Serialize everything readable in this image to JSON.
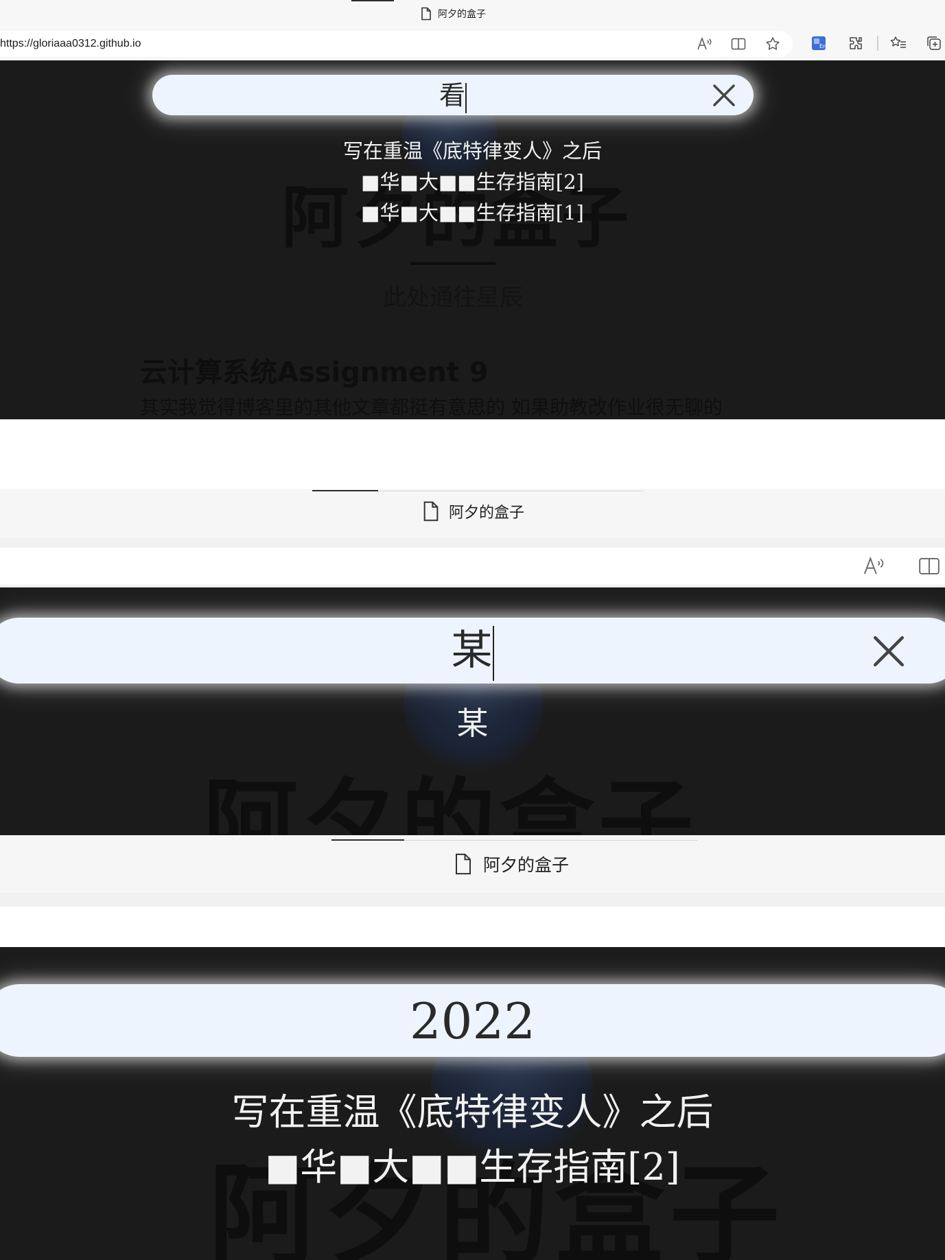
{
  "panel1": {
    "tab": {
      "title": "阿夕的盒子",
      "icon": "document-icon"
    },
    "address": {
      "url": "https://gloriaaa0312.github.io"
    },
    "toolbar_icons": [
      "read-aloud-icon",
      "split-screen-icon",
      "favorite-star-icon",
      "translate-icon",
      "extensions-icon",
      "favorites-list-icon",
      "collections-icon"
    ],
    "page": {
      "site_title": "阿夕的盒子",
      "site_subtitle": "此处通往星辰",
      "post_title": "云计算系统Assignment 9",
      "post_excerpt": "其实我觉得博客里的其他文章都挺有意思的 如果助教改作业很无聊的"
    },
    "search": {
      "query": "看",
      "results": [
        "写在重温《底特律变人》之后",
        "■华■大■■生存指南[2]",
        "■华■大■■生存指南[1]"
      ]
    }
  },
  "panel2": {
    "tab": {
      "title": "阿夕的盒子",
      "icon": "document-icon"
    },
    "toolbar_icons": [
      "read-aloud-icon",
      "split-screen-icon"
    ],
    "page": {
      "site_title": "阿夕的盒子"
    },
    "search": {
      "query": "某",
      "results": [
        "某"
      ]
    }
  },
  "panel3": {
    "tab": {
      "title": "阿夕的盒子",
      "icon": "document-icon"
    },
    "page": {
      "site_title": "阿夕的盒子"
    },
    "search": {
      "query": "2022",
      "results": [
        "写在重温《底特律变人》之后",
        "■华■大■■生存指南[2]"
      ]
    }
  },
  "colors": {
    "overlay": "#1b1b1b",
    "search_pill": "#eef4fd",
    "result_text": "#f2f2f2",
    "chrome": "#f7f7f7"
  }
}
